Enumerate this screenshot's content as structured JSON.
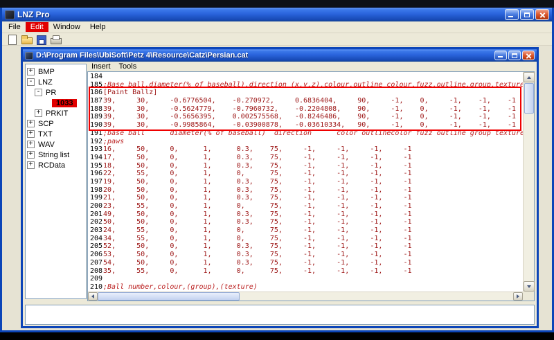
{
  "window": {
    "title": "LNZ Pro",
    "menu_bar": {
      "items": [
        {
          "label": "File",
          "highlighted": false
        },
        {
          "label": "Edit",
          "highlighted": true
        },
        {
          "label": "Window",
          "highlighted": false
        },
        {
          "label": "Help",
          "highlighted": false
        }
      ]
    },
    "toolbar": {
      "icons": [
        "new-document-icon",
        "open-folder-icon",
        "save-icon",
        "print-icon"
      ]
    }
  },
  "document_window": {
    "title": "D:\\Program Files\\UbiSoft\\Petz 4\\Resource\\Catz\\Persian.cat",
    "menu": {
      "items": [
        {
          "label": "Insert"
        },
        {
          "label": "Tools"
        }
      ]
    },
    "tree": {
      "items": [
        {
          "label": "BMP",
          "level": 0,
          "state": "collapsed",
          "highlighted": false
        },
        {
          "label": "LNZ",
          "level": 0,
          "state": "expanded",
          "highlighted": false
        },
        {
          "label": "PR",
          "level": 1,
          "state": "expanded",
          "highlighted": false
        },
        {
          "label": "1033",
          "level": 2,
          "state": "leaf",
          "highlighted": true
        },
        {
          "label": "PRKIT",
          "level": 1,
          "state": "collapsed",
          "highlighted": false
        },
        {
          "label": "SCP",
          "level": 0,
          "state": "collapsed",
          "highlighted": false
        },
        {
          "label": "TXT",
          "level": 0,
          "state": "collapsed",
          "highlighted": false
        },
        {
          "label": "WAV",
          "level": 0,
          "state": "collapsed",
          "highlighted": false
        },
        {
          "label": "String list",
          "level": 0,
          "state": "collapsed",
          "highlighted": false
        },
        {
          "label": "RCData",
          "level": 0,
          "state": "collapsed",
          "highlighted": false
        }
      ]
    },
    "editor": {
      "first_line": 184,
      "highlight": {
        "from_line": 186,
        "to_line": 190
      },
      "lines": [
        {
          "num": 184,
          "type": "blank",
          "text": ""
        },
        {
          "num": 185,
          "type": "comment",
          "text": ";Base ball,diameter(% of baseball),direction (x,y,z),colour,outline colour,fuzz,outline,group,texture"
        },
        {
          "num": 186,
          "type": "section",
          "text": "[Paint Ballz]"
        },
        {
          "num": 187,
          "type": "data",
          "text": "39,     30,     -0.6776504,    -0.270972,     0.6836404,     90,     -1,    0,     -1,    -1,    -1"
        },
        {
          "num": 188,
          "type": "data",
          "text": "39,     30,     -0.5624779,    -0.7960732,    -0.2204808,    90,     -1,    0,     -1,    -1,    -1"
        },
        {
          "num": 189,
          "type": "data",
          "text": "39,     30,     -0.5656395,    0.002575568,   -0.8246486,    90,     -1,    0,     -1,    -1,    -1"
        },
        {
          "num": 190,
          "type": "data",
          "text": "39,     30,     -0.9985864,    -0.03900878,   -0.03610334,   90,     -1,    0,     -1,    -1,    -1"
        },
        {
          "num": 191,
          "type": "comment",
          "text": ";base ball      diameter(% of baseball)  direction      color outlinecolor fuzz outline group texture"
        },
        {
          "num": 192,
          "type": "comment",
          "text": ";paws"
        },
        {
          "num": 193,
          "type": "data",
          "text": "16,     50,     0,      1,      0.3,    75,     -1,     -1,     -1,     -1"
        },
        {
          "num": 194,
          "type": "data",
          "text": "17,     50,     0,      1,      0.3,    75,     -1,     -1,     -1,     -1"
        },
        {
          "num": 195,
          "type": "data",
          "text": "18,     50,     0,      1,      0.3,    75,     -1,     -1,     -1,     -1"
        },
        {
          "num": 196,
          "type": "data",
          "text": "22,     55,     0,      1,      0,      75,     -1,     -1,     -1,     -1"
        },
        {
          "num": 197,
          "type": "data",
          "text": "19,     50,     0,      1,      0.3,    75,     -1,     -1,     -1,     -1"
        },
        {
          "num": 198,
          "type": "data",
          "text": "20,     50,     0,      1,      0.3,    75,     -1,     -1,     -1,     -1"
        },
        {
          "num": 199,
          "type": "data",
          "text": "21,     50,     0,      1,      0.3,    75,     -1,     -1,     -1,     -1"
        },
        {
          "num": 200,
          "type": "data",
          "text": "23,     55,     0,      1,      0,      75,     -1,     -1,     -1,     -1"
        },
        {
          "num": 201,
          "type": "data",
          "text": "49,     50,     0,      1,      0.3,    75,     -1,     -1,     -1,     -1"
        },
        {
          "num": 202,
          "type": "data",
          "text": "50,     50,     0,      1,      0.3,    75,     -1,     -1,     -1,     -1"
        },
        {
          "num": 203,
          "type": "data",
          "text": "24,     55,     0,      1,      0,      75,     -1,     -1,     -1,     -1"
        },
        {
          "num": 204,
          "type": "data",
          "text": "34,     55,     0,      1,      0,      75,     -1,     -1,     -1,     -1"
        },
        {
          "num": 205,
          "type": "data",
          "text": "52,     50,     0,      1,      0.3,    75,     -1,     -1,     -1,     -1"
        },
        {
          "num": 206,
          "type": "data",
          "text": "53,     50,     0,      1,      0.3,    75,     -1,     -1,     -1,     -1"
        },
        {
          "num": 207,
          "type": "data",
          "text": "54,     50,     0,      1,      0.3,    75,     -1,     -1,     -1,     -1"
        },
        {
          "num": 208,
          "type": "data",
          "text": "35,     55,     0,      1,      0,      75,     -1,     -1,     -1,     -1"
        },
        {
          "num": 209,
          "type": "blank",
          "text": ""
        },
        {
          "num": 210,
          "type": "comment",
          "text": ";Ball number,colour,(group),(texture)"
        }
      ]
    }
  },
  "annotations": {
    "color": "#e10000",
    "highlighted_menu": "Edit",
    "highlighted_tree_item": "1033",
    "boxed_lines": "186-190"
  },
  "colors": {
    "chrome": "#ece9d8",
    "titlebar_blue": "#2a64dc",
    "close_red": "#c83c14",
    "editor_data_text": "#9c1414",
    "editor_comment_text": "#bb2020",
    "line_number_text": "#000000",
    "annotation_red": "#e10000"
  }
}
